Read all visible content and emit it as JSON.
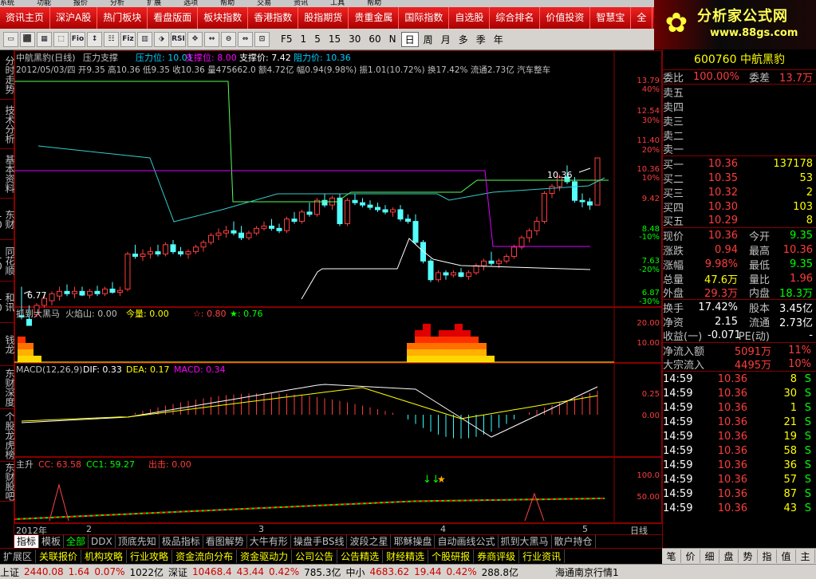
{
  "topmenu": [
    "系统",
    "功能",
    "报价",
    "分析",
    "扩展",
    "选项",
    "帮助",
    "交易",
    "资讯",
    "工具",
    "帮助"
  ],
  "nav": [
    "资讯主页",
    "深沪A股",
    "热门板块",
    "看盘版面",
    "板块指数",
    "香港指数",
    "股指期货",
    "贵重金属",
    "国际指数",
    "自选股",
    "综合排名",
    "价值投资",
    "智慧宝",
    "全"
  ],
  "logo": {
    "brand": "分析家公式网",
    "url": "www.88gs.com"
  },
  "toolbar": {
    "icons": [
      "▭",
      "⬛",
      "▦",
      "⬚",
      "Fio",
      "↕",
      "☷",
      "Fiz",
      "▥",
      "⬗",
      "RSI",
      "✥",
      "↔",
      "⊖",
      "⇔",
      "⊡"
    ],
    "periods": [
      "F5",
      "1",
      "5",
      "15",
      "30",
      "60",
      "N",
      "日",
      "周",
      "月",
      "多",
      "季",
      "年"
    ],
    "active_period": "日"
  },
  "sidetabs": [
    "分时走势",
    "技术分析",
    "基本资料",
    "东财10",
    "同花顺10",
    "和讯10",
    "钱龙",
    "东财深度",
    "个股龙虎榜",
    "东财股吧"
  ],
  "main": {
    "title": "中航黑豹(日线)",
    "indicator": "压力支撑",
    "pressure": "压力位: 10.01",
    "support": "支撑位: 8.00",
    "support_price": "支撑价: 7.42",
    "resist_price": "阻力价: 10.36",
    "info": "2012/05/03/四 开9.35 高10.36 低9.35 收10.36 量475662.0 额4.72亿 幅0.94(9.98%) 振1.01(10.72%) 换17.42% 流通2.73亿 汽车整车",
    "hi_label": "10.36",
    "lo_label": "6.77",
    "yaxis": [
      "13.79",
      "40%",
      "12.54",
      "30%",
      "11.40",
      "20%",
      "10.36",
      "10%",
      "9.42",
      "8.48",
      "-10%",
      "7.63",
      "-20%",
      "6.87",
      "-30%"
    ]
  },
  "panel2": {
    "name": "抓到大黑马",
    "fire": "火焰山: 0.00",
    "vol": "今量: 0.00",
    "star_red": "☆: 0.80",
    "star_grn": "★: 0.76",
    "yaxis": [
      "20.00",
      "10.00"
    ]
  },
  "panel3": {
    "name": "MACD(12,26,9)",
    "dif": "DIF: 0.33",
    "dea": "DEA: 0.17",
    "macd": "MACD: 0.34",
    "yaxis": [
      "0.25",
      "0.00"
    ]
  },
  "panel4": {
    "name": "主升",
    "cc": "CC: 63.58",
    "cc1": "CC1: 59.27",
    "out": "出击: 0.00",
    "yaxis": [
      "100.0",
      "50.00"
    ]
  },
  "xaxis": {
    "labels": [
      "2012年",
      "2",
      "3",
      "4",
      "5"
    ],
    "period": "日线"
  },
  "bottomtabs": [
    "指标",
    "模板",
    "全部",
    "DDX",
    "顶底先知",
    "极品指标",
    "看图解势",
    "大牛有形",
    "操盘手BS线",
    "波段之星",
    "耶稣操盘",
    "自动画线公式",
    "抓到大黑马",
    "散户持仓"
  ],
  "linkbar": [
    "扩展区",
    "关联报价",
    "机构攻略",
    "行业攻略",
    "资金流向分布",
    "资金驱动力",
    "公司公告",
    "公告精选",
    "财经精选",
    "个股研报",
    "券商评级",
    "行业资讯"
  ],
  "right": {
    "code": "600760",
    "name": "中航黑豹",
    "weibi": {
      "label": "委比",
      "val": "100.00%",
      "label2": "委差",
      "val2": "13.7万"
    },
    "asks": [
      "卖五",
      "卖四",
      "卖三",
      "卖二",
      "卖一"
    ],
    "bids": [
      {
        "l": "买一",
        "p": "10.36",
        "v": "137178"
      },
      {
        "l": "买二",
        "p": "10.35",
        "v": "53"
      },
      {
        "l": "买三",
        "p": "10.32",
        "v": "2"
      },
      {
        "l": "买四",
        "p": "10.30",
        "v": "103"
      },
      {
        "l": "买五",
        "p": "10.29",
        "v": "8"
      }
    ],
    "stats": [
      {
        "a": "现价",
        "b": "10.36",
        "c": "今开",
        "d": "9.35",
        "bc": "c-red",
        "dc": "c-grn"
      },
      {
        "a": "涨跌",
        "b": "0.94",
        "c": "最高",
        "d": "10.36",
        "bc": "c-red",
        "dc": "c-red"
      },
      {
        "a": "涨幅",
        "b": "9.98%",
        "c": "最低",
        "d": "9.35",
        "bc": "c-red",
        "dc": "c-grn"
      },
      {
        "a": "总量",
        "b": "47.6万",
        "c": "量比",
        "d": "1.96",
        "bc": "c-yel",
        "dc": "c-red"
      },
      {
        "a": "外盘",
        "b": "29.3万",
        "c": "内盘",
        "d": "18.3万",
        "bc": "c-red",
        "dc": "c-grn"
      }
    ],
    "stats2": [
      {
        "a": "换手",
        "b": "17.42%",
        "c": "股本",
        "d": "3.45亿"
      },
      {
        "a": "净资",
        "b": "2.15",
        "c": "流通",
        "d": "2.73亿"
      },
      {
        "a": "收益(一)",
        "b": "-0.071",
        "c": "PE(动)",
        "d": "-"
      }
    ],
    "flow": [
      {
        "a": "净流入额",
        "b": "5091万",
        "c": "11%"
      },
      {
        "a": "大宗流入",
        "b": "4495万",
        "c": "10%"
      }
    ],
    "ticks": [
      {
        "t": "14:59",
        "p": "10.36",
        "v": "8",
        "f": "S"
      },
      {
        "t": "14:59",
        "p": "10.36",
        "v": "30",
        "f": "S"
      },
      {
        "t": "14:59",
        "p": "10.36",
        "v": "1",
        "f": "S"
      },
      {
        "t": "14:59",
        "p": "10.36",
        "v": "21",
        "f": "S"
      },
      {
        "t": "14:59",
        "p": "10.36",
        "v": "19",
        "f": "S"
      },
      {
        "t": "14:59",
        "p": "10.36",
        "v": "58",
        "f": "S"
      },
      {
        "t": "14:59",
        "p": "10.36",
        "v": "36",
        "f": "S"
      },
      {
        "t": "14:59",
        "p": "10.36",
        "v": "57",
        "f": "S"
      },
      {
        "t": "14:59",
        "p": "10.36",
        "v": "87",
        "f": "S"
      },
      {
        "t": "14:59",
        "p": "10.36",
        "v": "43",
        "f": "S"
      }
    ],
    "tabs": [
      "笔",
      "价",
      "细",
      "盘",
      "势",
      "指",
      "值",
      "主"
    ]
  },
  "status": {
    "sh": "上证",
    "sh_v": "2440.08",
    "sh_c": "1.64",
    "sh_p": "0.07%",
    "sh_a": "1022亿",
    "sz": "深证",
    "sz_v": "10468.4",
    "sz_c": "43.44",
    "sz_p": "0.42%",
    "sz_a": "785.3亿",
    "zx": "中小",
    "zx_v": "4683.62",
    "zx_c": "19.44",
    "zx_p": "0.42%",
    "zx_a": "288.8亿",
    "broker": "海通南京行情1"
  }
}
